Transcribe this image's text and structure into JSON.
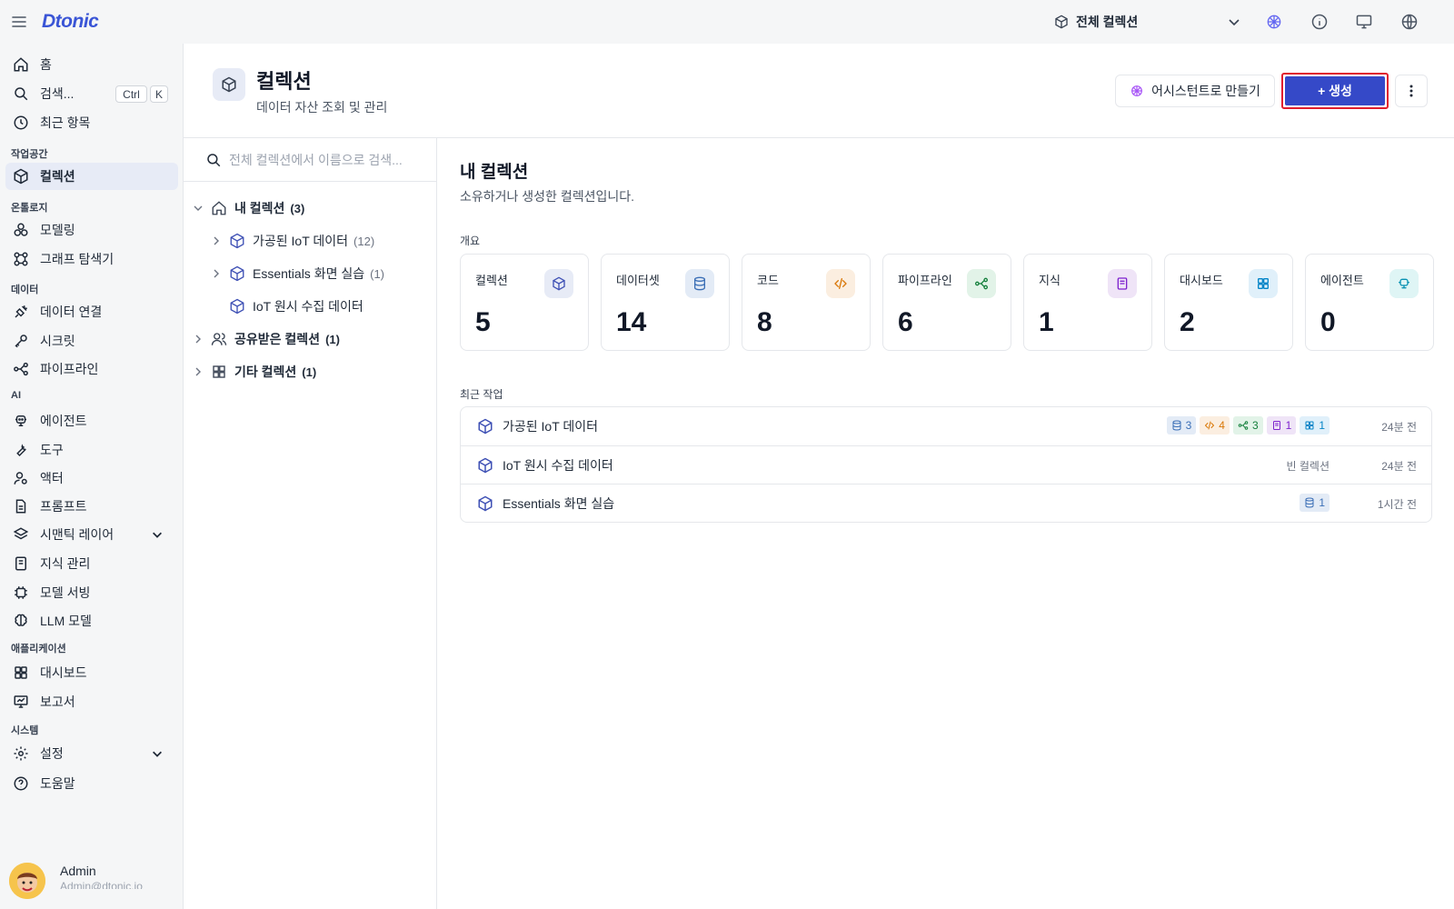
{
  "topbar": {
    "logo": "Dtonic",
    "collection_selector": "전체 컬렉션"
  },
  "sidebar": {
    "home": "홈",
    "search": "검색...",
    "search_kbd": [
      "Ctrl",
      "K"
    ],
    "recent": "최근 항목",
    "sections": {
      "workspace": "작업공간",
      "ontology": "온톨로지",
      "data": "데이터",
      "ai": "AI",
      "apps": "애플리케이션",
      "system": "시스템"
    },
    "items": {
      "collections": "컬렉션",
      "modeling": "모델링",
      "graph": "그래프 탐색기",
      "data_conn": "데이터 연결",
      "secrets": "시크릿",
      "pipelines": "파이프라인",
      "agents": "에이전트",
      "tools": "도구",
      "actors": "액터",
      "prompts": "프롬프트",
      "semantic": "시맨틱 레이어",
      "knowledge": "지식 관리",
      "model_serving": "모델 서빙",
      "llm": "LLM 모델",
      "dashboards": "대시보드",
      "reports": "보고서",
      "settings": "설정",
      "help": "도움말"
    },
    "profile": {
      "name": "Admin",
      "email": "Admin@dtonic.io"
    }
  },
  "header": {
    "title": "컬렉션",
    "subtitle": "데이터 자산 조회 및 관리",
    "assistant_btn": "어시스턴트로 만들기",
    "create_btn": "+ 생성"
  },
  "tree": {
    "search_placeholder": "전체 컬렉션에서 이름으로 검색...",
    "nodes": [
      {
        "name": "내 컬렉션",
        "count": "(3)"
      },
      {
        "name": "가공된 IoT 데이터",
        "count": "(12)"
      },
      {
        "name": "Essentials 화면 실습",
        "count": "(1)"
      },
      {
        "name": "IoT 원시 수집 데이터",
        "count": ""
      },
      {
        "name": "공유받은 컬렉션",
        "count": "(1)"
      },
      {
        "name": "기타 컬렉션",
        "count": "(1)"
      }
    ]
  },
  "content": {
    "title": "내 컬렉션",
    "subtitle": "소유하거나 생성한 컬렉션입니다.",
    "overview_label": "개요",
    "stats": [
      {
        "label": "컬렉션",
        "value": "5",
        "icon": "cube-icon",
        "color": "#3f51b5",
        "bg": "#e7ebf6"
      },
      {
        "label": "데이터셋",
        "value": "14",
        "icon": "database-icon",
        "color": "#3b6fb6",
        "bg": "#e3ebf6"
      },
      {
        "label": "코드",
        "value": "8",
        "icon": "code-icon",
        "color": "#d97706",
        "bg": "#fbeee0"
      },
      {
        "label": "파이프라인",
        "value": "6",
        "icon": "pipeline-icon",
        "color": "#15803d",
        "bg": "#e2f3e8"
      },
      {
        "label": "지식",
        "value": "1",
        "icon": "book-icon",
        "color": "#7e22ce",
        "bg": "#efe4f7"
      },
      {
        "label": "대시보드",
        "value": "2",
        "icon": "dashboard-icon",
        "color": "#0284c7",
        "bg": "#e0f0fa"
      },
      {
        "label": "에이전트",
        "value": "0",
        "icon": "agent-icon",
        "color": "#0891b2",
        "bg": "#dff5f5"
      }
    ],
    "recent_label": "최근 작업",
    "recent": [
      {
        "name": "가공된 IoT 데이터",
        "time": "24분 전",
        "badges": [
          {
            "icon": "database-icon",
            "value": "3",
            "color": "#3b6fb6",
            "bg": "#e3ebf6"
          },
          {
            "icon": "code-icon",
            "value": "4",
            "color": "#d97706",
            "bg": "#fbeee0"
          },
          {
            "icon": "pipeline-icon",
            "value": "3",
            "color": "#15803d",
            "bg": "#e2f3e8"
          },
          {
            "icon": "book-icon",
            "value": "1",
            "color": "#7e22ce",
            "bg": "#efe4f7"
          },
          {
            "icon": "dashboard-icon",
            "value": "1",
            "color": "#0284c7",
            "bg": "#e0f0fa"
          }
        ]
      },
      {
        "name": "IoT 원시 수집 데이터",
        "time": "24분 전",
        "empty": "빈 컬렉션"
      },
      {
        "name": "Essentials 화면 실습",
        "time": "1시간 전",
        "badges": [
          {
            "icon": "database-icon",
            "value": "1",
            "color": "#3b6fb6",
            "bg": "#e3ebf6"
          }
        ]
      }
    ]
  },
  "colors": {
    "accent": "#3549c8",
    "highlight": "#e11d2e",
    "active_bg": "#e7ebf6"
  }
}
